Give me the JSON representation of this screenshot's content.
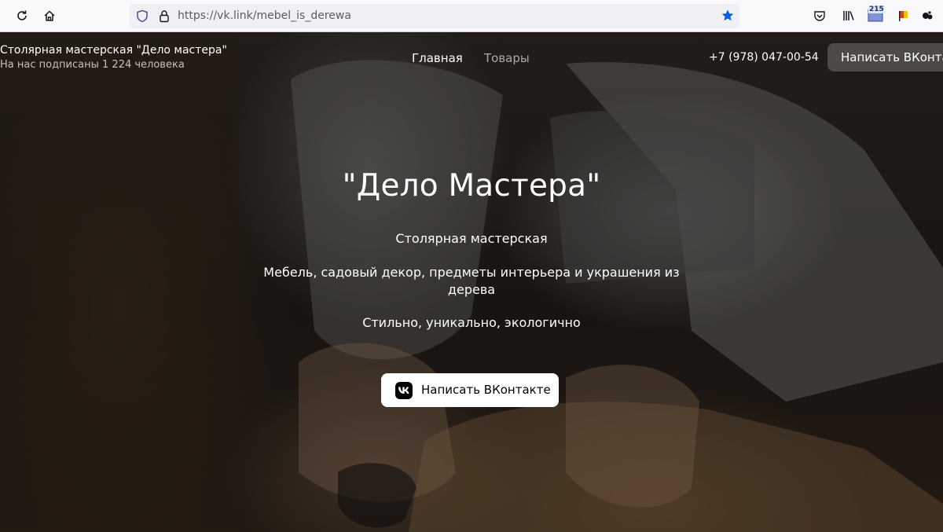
{
  "browser": {
    "url_host": "https://vk.link",
    "url_path": "/mebel_is_derewa",
    "extension_badge": "215",
    "star_color": "#0061e0"
  },
  "header": {
    "title": "Столярная мастерская \"Дело мастера\"",
    "subscribers": "На нас подписаны 1 224 человека",
    "nav": {
      "home": "Главная",
      "goods": "Товары"
    },
    "phone": "+7 (978) 047-00-54",
    "message_button": "Написать ВКонтакте"
  },
  "hero": {
    "title": "\"Дело Мастера\"",
    "subtitle": "Столярная мастерская",
    "description": "Мебель, садовый декор, предметы интерьера и украшения из дерева",
    "tagline": "Стильно, уникально, экологично",
    "cta_label": "Написать ВКонтакте",
    "cta_icon": "vk-logo-icon"
  }
}
